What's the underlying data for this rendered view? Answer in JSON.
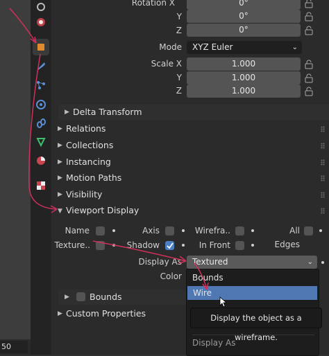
{
  "viewport": {
    "zoom_value": "50"
  },
  "transform": {
    "rotation_x_label": "Rotation X",
    "rotation_x": "0°",
    "y_label": "Y",
    "rotation_y": "0°",
    "z_label": "Z",
    "rotation_z": "0°",
    "mode_label": "Mode",
    "mode_value": "XYZ Euler",
    "scale_x_label": "Scale X",
    "scale_x": "1.000",
    "scale_y": "1.000",
    "scale_z": "1.000"
  },
  "sections": {
    "delta_transform": "Delta Transform",
    "relations": "Relations",
    "collections": "Collections",
    "instancing": "Instancing",
    "motion_paths": "Motion Paths",
    "visibility": "Visibility",
    "viewport_display": "Viewport Display",
    "bounds": "Bounds",
    "custom_properties": "Custom Properties"
  },
  "viewport_display": {
    "name_label": "Name",
    "name_checked": false,
    "axis_label": "Axis",
    "axis_checked": false,
    "wireframe_label": "Wirefra..",
    "wireframe_checked": false,
    "all_edges_label": "All Edges",
    "all_edges_checked": false,
    "texture_label": "Texture..",
    "texture_checked": false,
    "shadow_label": "Shadow",
    "shadow_checked": true,
    "in_front_label": "In Front",
    "in_front_checked": false,
    "display_as_label": "Display As",
    "display_as_value": "Textured",
    "color_label": "Color"
  },
  "dropdown": {
    "items": [
      "Bounds",
      "Wire"
    ],
    "highlighted": "Wire",
    "footer_label": "Display As"
  },
  "tooltip": {
    "text": "Display the object as a wireframe."
  },
  "colors": {
    "accent_blue": "#4a7fc1",
    "highlight_blue": "#4f78b3",
    "annotation_arrow": "#d0305a"
  },
  "icons": [
    "tool-icon",
    "render-icon",
    "object-icon",
    "modifier-icon",
    "particles-icon",
    "physics-icon",
    "constraints-icon",
    "data-icon",
    "material-icon",
    "texture-icon",
    "lock-icon",
    "mouse-cursor-icon"
  ]
}
